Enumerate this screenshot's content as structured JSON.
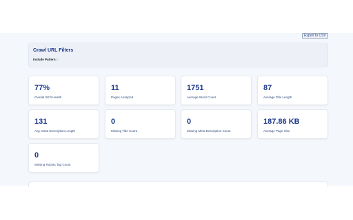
{
  "toolbar": {
    "export_label": "Export to CSV"
  },
  "filters": {
    "title": "Crawl URL Filters",
    "include_label": "Include Pattern:",
    "include_value": ".*"
  },
  "metrics": [
    {
      "value": "77%",
      "label": "Overall SEO Health"
    },
    {
      "value": "11",
      "label": "Pages Analyzed"
    },
    {
      "value": "1751",
      "label": "Average Word Count"
    },
    {
      "value": "87",
      "label": "Average Title Length"
    },
    {
      "value": "131",
      "label": "Avg. Meta Description Length"
    },
    {
      "value": "0",
      "label": "Missing Title Count"
    },
    {
      "value": "0",
      "label": "Missing Meta Description Count"
    },
    {
      "value": "187.86 KB",
      "label": "Average Page Size"
    },
    {
      "value": "0",
      "label": "Missing Robots Tag Count"
    }
  ]
}
